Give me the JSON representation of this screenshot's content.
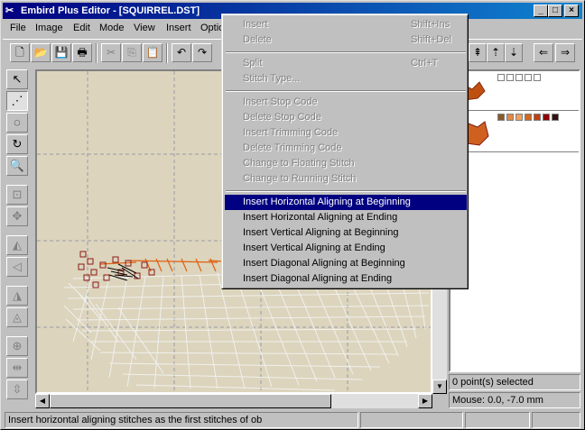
{
  "window": {
    "title": "Embird Plus Editor - [SQUIRREL.DST]"
  },
  "menubar": [
    "File",
    "Image",
    "Edit",
    "Mode",
    "View",
    "Insert",
    "Optio"
  ],
  "popup_menu": {
    "items": [
      {
        "label": "Insert",
        "shortcut": "Shift+Ins",
        "state": "disabled"
      },
      {
        "label": "Delete",
        "shortcut": "Shift+Del",
        "state": "disabled"
      },
      {
        "label": "Split",
        "shortcut": "Ctrl+T",
        "state": "disabled"
      },
      {
        "label": "Stitch Type...",
        "shortcut": "",
        "state": "disabled"
      },
      {
        "label": "Insert Stop Code",
        "shortcut": "",
        "state": "disabled"
      },
      {
        "label": "Delete Stop Code",
        "shortcut": "",
        "state": "disabled"
      },
      {
        "label": "Insert Trimming Code",
        "shortcut": "",
        "state": "disabled"
      },
      {
        "label": "Delete Trimming Code",
        "shortcut": "",
        "state": "disabled"
      },
      {
        "label": "Change to Floating Stitch",
        "shortcut": "",
        "state": "disabled"
      },
      {
        "label": "Change to Running Stitch",
        "shortcut": "",
        "state": "disabled"
      },
      {
        "label": "Insert Horizontal Aligning at Beginning",
        "shortcut": "",
        "state": "selected"
      },
      {
        "label": "Insert Horizontal Aligning at Ending",
        "shortcut": "",
        "state": "enabled"
      },
      {
        "label": "Insert Vertical Aligning at Beginning",
        "shortcut": "",
        "state": "enabled"
      },
      {
        "label": "Insert Vertical Aligning at Ending",
        "shortcut": "",
        "state": "enabled"
      },
      {
        "label": "Insert Diagonal Aligning at Beginning",
        "shortcut": "",
        "state": "enabled"
      },
      {
        "label": "Insert Diagonal Aligning at Ending",
        "shortcut": "",
        "state": "enabled"
      }
    ]
  },
  "right_panel": {
    "palette_colors": [
      "#8b5a2b",
      "#e08a4a",
      "#f0a060",
      "#d06a20",
      "#c04010",
      "#8b0000",
      "#301010"
    ]
  },
  "info": {
    "points_selected": "0 point(s) selected",
    "mouse": "Mouse: 0.0, -7.0 mm"
  },
  "status": {
    "hint": "Insert horizontal aligning stitches as the first stitches of ob"
  },
  "colors": {
    "title_bar": "#000080",
    "selection": "#000080",
    "canvas_bg": "#dcd4bc",
    "stitch_orange": "#e06010",
    "stitch_dark": "#8b1a1a",
    "stitch_white": "#f0f0f0"
  }
}
